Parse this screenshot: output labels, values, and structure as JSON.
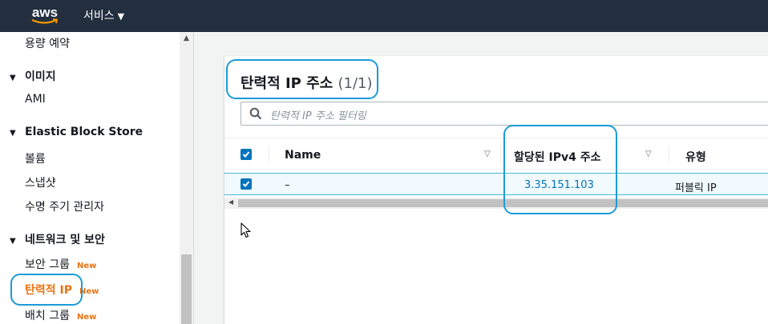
{
  "topbar": {
    "logo_text": "aws",
    "services_label": "서비스"
  },
  "sidebar": {
    "reserved_capacity": "용량 예약",
    "images_heading": "이미지",
    "ami": "AMI",
    "ebs_heading": "Elastic Block Store",
    "volumes": "볼륨",
    "snapshots": "스냅샷",
    "lifecycle_manager": "수명 주기 관리자",
    "network_heading": "네트워크 및 보안",
    "security_groups": "보안 그룹",
    "elastic_ips": "탄력적 IP",
    "placement_groups": "배치 그룹",
    "new_badge": "New"
  },
  "panel": {
    "title": "탄력적 IP 주소",
    "count": "(1/1)",
    "search_placeholder": "탄력적 IP 주소 필터링",
    "columns": {
      "name": "Name",
      "allocated_ipv4": "할당된 IPv4 주소",
      "type": "유형"
    },
    "rows": [
      {
        "name": "–",
        "ipv4": "3.35.151.103",
        "type": "퍼블릭 IP",
        "selected": true
      }
    ]
  },
  "colors": {
    "topbar_bg": "#232f3e",
    "accent_orange": "#ec7211",
    "link_blue": "#0073bb",
    "callout_blue": "#1a9bd7"
  },
  "icons": [
    "search-icon",
    "caret-down-icon",
    "checkbox-checked-icon",
    "sort-icon",
    "mouse-cursor-icon"
  ]
}
